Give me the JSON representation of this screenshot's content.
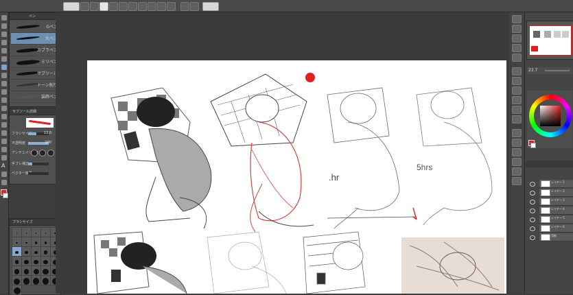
{
  "brush_panel": {
    "tab_label": "ペン",
    "brushes": [
      {
        "label": "Gペン"
      },
      {
        "label": "丸ペン"
      },
      {
        "label": "カブラペン"
      },
      {
        "label": "ミリペン"
      },
      {
        "label": "サブツール"
      },
      {
        "label": "トーン削り"
      },
      {
        "label": "装飾ペン"
      }
    ]
  },
  "tool_property": {
    "title": "サブツール詳細",
    "rows": [
      {
        "label": "ブラシサイズ",
        "value": "13.0",
        "level": 0.4
      },
      {
        "label": "不透明度",
        "value": "100",
        "level": 1.0
      },
      {
        "label": "アンチエイリアス",
        "value": "",
        "level": 0
      },
      {
        "label": "手ブレ補正",
        "value": "",
        "level": 0.2
      },
      {
        "label": "ベクター吸着",
        "value": "",
        "level": 0
      }
    ]
  },
  "brush_size_panel": {
    "title": "ブラシサイズ",
    "sizes": [
      "0.7",
      "1",
      "1.5",
      "2",
      "2.5",
      "3",
      "4",
      "5",
      "6",
      "7",
      "8",
      "10",
      "12",
      "15",
      "17",
      "20",
      "25",
      "30",
      "40",
      "50",
      "60",
      "70",
      "80",
      "100",
      "120",
      "150",
      "170",
      "200",
      "250",
      "300",
      "400"
    ],
    "selected_index": 10
  },
  "canvas": {
    "annotations": [
      {
        "text": ".hr"
      },
      {
        "text": "5hrs"
      }
    ]
  },
  "color_panel": {
    "zoom_value": "23.7"
  },
  "layers": [
    {
      "name": "レイヤー 1"
    },
    {
      "name": "レイヤー 2"
    },
    {
      "name": "レイヤー 3"
    },
    {
      "name": "レイヤー 4"
    },
    {
      "name": "レイヤー 5"
    },
    {
      "name": "レイヤー 6"
    },
    {
      "name": "用紙"
    }
  ],
  "colors": {
    "accent": "#6d8fb3",
    "red_mark": "#e02020",
    "sketch_red": "#d94040"
  }
}
